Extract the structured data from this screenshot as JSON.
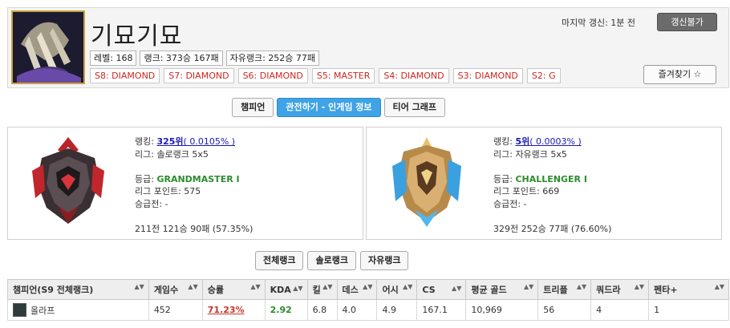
{
  "profile": {
    "name": "기묘기묘",
    "level": "레벨: 168",
    "rank_record": "랭크: 373승 167패",
    "flex_record": "자유랭크: 252승 77패",
    "seasons": [
      "S8: DIAMOND",
      "S7: DIAMOND",
      "S6: DIAMOND",
      "S5: MASTER",
      "S4: DIAMOND",
      "S3: DIAMOND",
      "S2: G"
    ],
    "last_update": "마지막 갱신: 1분 전",
    "update_button": "갱신불가",
    "favorite_button": "즐겨찾기 ☆"
  },
  "modes": [
    "챔피언",
    "관전하기 - 인게임 정보",
    "티어 그래프"
  ],
  "solo": {
    "rank_label": "랭킹: ",
    "rank_link": "325위",
    "rank_pct": "( 0.0105% )",
    "league": "리그: 솔로랭크 5x5",
    "tier_label": "등급: ",
    "tier": "GRANDMASTER I",
    "lp": "리그 포인트: 575",
    "promo": "승급전: -",
    "record": "211전 121승 90패 (57.35%)"
  },
  "flex": {
    "rank_label": "랭킹: ",
    "rank_link": "5위",
    "rank_pct": "( 0.0003% )",
    "league": "리그: 자유랭크 5x5",
    "tier_label": "등급: ",
    "tier": "CHALLENGER I",
    "lp": "리그 포인트: 669",
    "promo": "승급전: -",
    "record": "329전 252승 77패 (76.60%)"
  },
  "rank_types": [
    "전체랭크",
    "솔로랭크",
    "자유랭크"
  ],
  "table": {
    "headers": [
      "챔피언(S9 전체랭크)",
      "게임수",
      "승률",
      "KDA",
      "킬",
      "데스",
      "어시",
      "CS",
      "평균 골드",
      "트리플",
      "쿼드라",
      "펜타+"
    ],
    "row": {
      "champion": "올라프",
      "games": "452",
      "winrate": "71.23%",
      "kda": "2.92",
      "kills": "6.8",
      "deaths": "4.0",
      "assists": "4.9",
      "cs": "167.1",
      "gold": "10,969",
      "triple": "56",
      "quadra": "4",
      "penta": "1"
    }
  },
  "colors": {
    "accent_blue": "#3fa3e6",
    "season_red": "#d0251d",
    "tier_green": "#2e8b2e",
    "winrate_red": "#c0392b",
    "link_blue": "#1a1ab5"
  }
}
